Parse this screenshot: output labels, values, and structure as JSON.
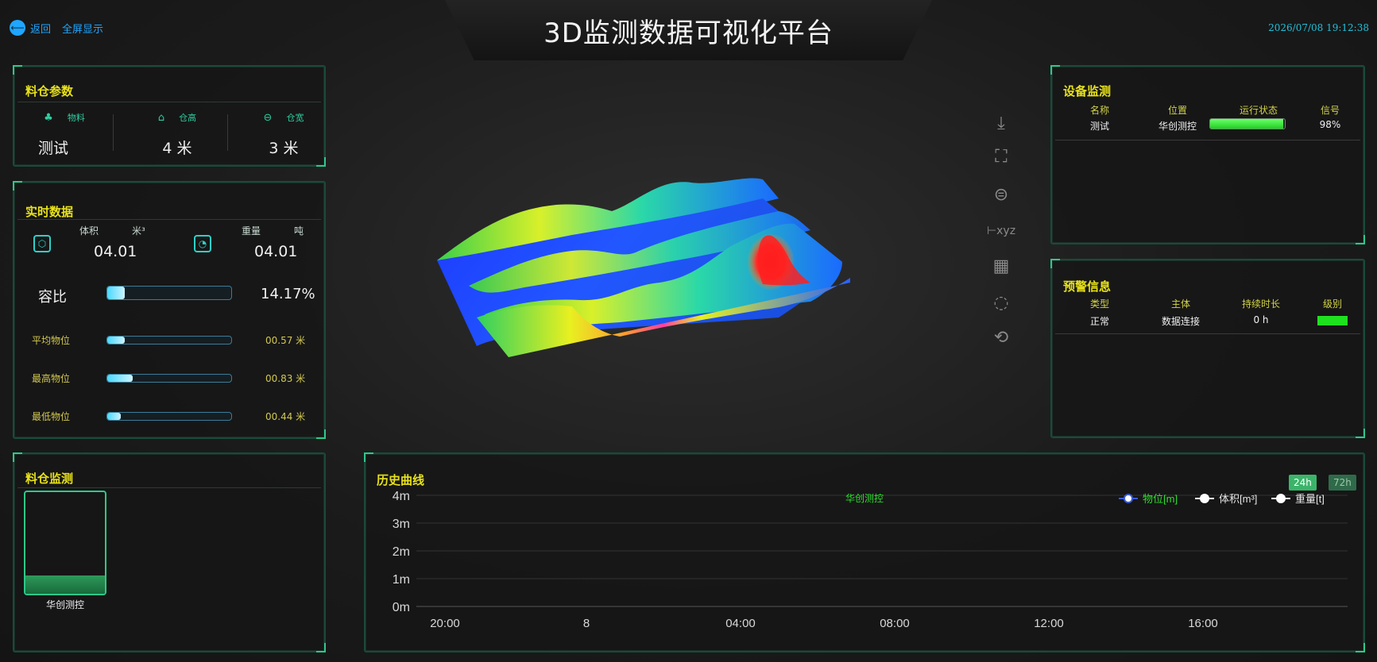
{
  "header": {
    "title": "3D监测数据可视化平台",
    "back_label": "返回",
    "fullscreen_label": "全屏显示",
    "datetime": "2026/07/08 19:12:38"
  },
  "bin_params": {
    "title": "料仓参数",
    "columns": [
      {
        "icon": "tree-icon",
        "label": "物料",
        "value": "测试"
      },
      {
        "icon": "home-icon",
        "label": "仓高",
        "value": "4 米"
      },
      {
        "icon": "minus-circle-icon",
        "label": "仓宽",
        "value": "3 米"
      }
    ]
  },
  "realtime": {
    "title": "实时数据",
    "volume_label": "体积",
    "volume_unit": "米³",
    "volume_value": "04.01",
    "weight_label": "重量",
    "weight_unit": "吨",
    "weight_value": "04.01",
    "ratio_label": "容比",
    "ratio_value": "14.17%",
    "ratio_fraction": 0.1417,
    "rows": [
      {
        "label": "平均物位",
        "value": "00.57 米",
        "fraction": 0.1425
      },
      {
        "label": "最高物位",
        "value": "00.83 米",
        "fraction": 0.2075
      },
      {
        "label": "最低物位",
        "value": "00.44 米",
        "fraction": 0.11
      }
    ]
  },
  "bin_monitor": {
    "title": "料仓监测",
    "bin_name": "华创测控",
    "fill_fraction": 0.18
  },
  "device": {
    "title": "设备监测",
    "headers": [
      "名称",
      "位置",
      "运行状态",
      "信号"
    ],
    "row": {
      "name": "测试",
      "location": "华创测控",
      "signal": "98%",
      "status_fraction": 0.98
    }
  },
  "warning": {
    "title": "预警信息",
    "headers": [
      "类型",
      "主体",
      "持续时长",
      "级别"
    ],
    "row": {
      "type": "正常",
      "subject": "数据连接",
      "duration": "0 h"
    },
    "level_color": "#1fe01f"
  },
  "toolbar": {
    "icons": [
      "download-icon",
      "focus-frame-icon",
      "bin-shape-icon",
      "xyz-axis-icon",
      "grid-icon",
      "rotate-icon",
      "refresh-icon"
    ]
  },
  "history": {
    "title": "历史曲线",
    "btn_24h": "24h",
    "btn_72h": "72h",
    "annotation": "华创测控"
  },
  "chart_data": {
    "type": "line",
    "title": "历史曲线",
    "y_ticks": [
      "4m",
      "3m",
      "2m",
      "1m",
      "0m"
    ],
    "x_ticks": [
      "20:00",
      "8",
      "04:00",
      "08:00",
      "12:00",
      "16:00"
    ],
    "ylim": [
      0,
      4
    ],
    "grid": true,
    "legend_position": "top-right",
    "series": [
      {
        "name": "物位[m]",
        "color": "#3a5ad8",
        "values": []
      },
      {
        "name": "体积[m³]",
        "color": "#ffffff",
        "values": []
      },
      {
        "name": "重量[t]",
        "color": "#ffffff",
        "values": []
      }
    ]
  },
  "colors": {
    "accent": "#2ec88a",
    "title_yellow": "#e8e21a",
    "link_blue": "#1fa6ff"
  }
}
